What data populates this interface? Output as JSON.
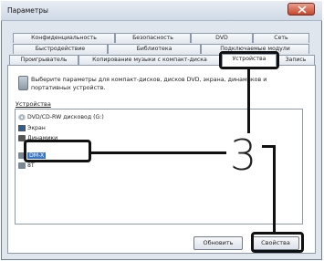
{
  "window": {
    "title": "Параметры"
  },
  "tabs": {
    "row1": [
      "Конфиденциальность",
      "Безопасность",
      "DVD",
      "Сеть"
    ],
    "row2": [
      "Быстродействие",
      "Библиотека",
      "Подключаемые модули"
    ],
    "row3": [
      "Проигрыватель",
      "Копирование музыки с компакт-диска",
      "Устройства",
      "Запись"
    ],
    "active": "Устройства"
  },
  "panel": {
    "description": "Выберите параметры для компакт-дисков, дисков DVD, экрана, динамиков и портативных устройств.",
    "devices_label": "Устройства",
    "devices": [
      {
        "label": "DVD/CD-RW дисковод (G:)",
        "icon": "optical-drive-icon"
      },
      {
        "label": "Экран",
        "icon": "monitor-icon"
      },
      {
        "label": "Динамики",
        "icon": "speaker-icon"
      },
      {
        "label": "DM-X",
        "icon": "portable-device-icon",
        "selected": true
      },
      {
        "label": "8T",
        "icon": "portable-device-icon"
      }
    ],
    "refresh_button": "Обновить",
    "properties_button": "Свойства"
  },
  "annotation": {
    "step_number": "3"
  }
}
